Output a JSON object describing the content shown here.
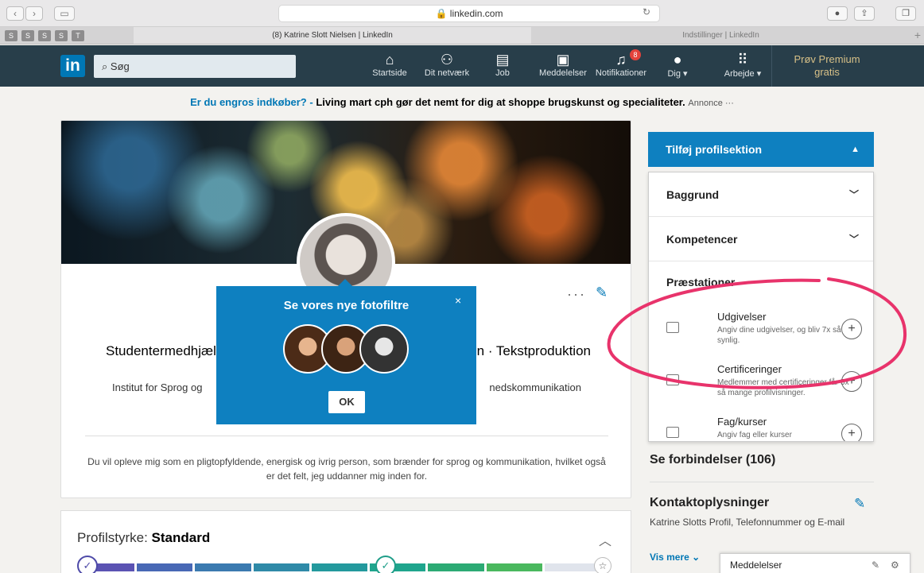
{
  "browser": {
    "address": "🔒 linkedin.com",
    "favorites": [
      "S",
      "S",
      "S",
      "S",
      "T"
    ],
    "tabs": [
      "(8) Katrine Slott Nielsen | LinkedIn",
      "Indstillinger | LinkedIn"
    ]
  },
  "nav": {
    "search_placeholder": "Søg",
    "items": [
      {
        "label": "Startside",
        "icon": "home-icon"
      },
      {
        "label": "Dit netværk",
        "icon": "network-icon"
      },
      {
        "label": "Job",
        "icon": "briefcase-icon"
      },
      {
        "label": "Meddelelser",
        "icon": "messages-icon"
      },
      {
        "label": "Notifikationer",
        "icon": "bell-icon",
        "badge": "8"
      },
      {
        "label": "Dig ▾",
        "icon": "avatar-icon"
      },
      {
        "label": "Arbejde ▾",
        "icon": "grid-icon"
      }
    ],
    "premium": "Prøv Premium gratis"
  },
  "ad": {
    "question": "Er du engros indkøber? -",
    "text": "Living mart cph gør det nemt for dig at shoppe brugskunst og specialiteter.",
    "note": "Annonce ···"
  },
  "profile": {
    "headline_left": "Studentermedhjæl",
    "headline_right": "n · Tekstproduktion",
    "school_left": "Institut for Sprog og",
    "school_right": "nedskommunikation",
    "summary": "Du vil opleve mig som en pligtopfyldende, energisk og ivrig person, som brænder for sprog og kommunikation, hvilket også er det felt, jeg uddanner mig inden for."
  },
  "popup": {
    "title": "Se vores nye fotofiltre",
    "close": "×",
    "ok": "OK"
  },
  "strength": {
    "label": "Profilstyrke:",
    "level": "Standard",
    "segments": [
      "#5b53b3",
      "#4868b5",
      "#3b7ab0",
      "#2f8aa8",
      "#23999d",
      "#1fa58d",
      "#2caa74",
      "#4ab85e",
      "#e0e4ec"
    ]
  },
  "sidebar": {
    "add_section": "Tilføj profilsektion",
    "sections": [
      "Baggrund",
      "Kompetencer"
    ],
    "subsection": "Præstationer",
    "items": [
      {
        "title": "Udgivelser",
        "desc": "Angiv dine udgivelser, og bliv 7x så synlig."
      },
      {
        "title": "Certificeringer",
        "desc": "Medlemmer med certificeringer får 5x så mange profilvisninger."
      },
      {
        "title": "Fag/kurser",
        "desc": "Angiv fag eller kurser"
      }
    ],
    "connections": "Se forbindelser (106)",
    "contact_title": "Kontaktoplysninger",
    "contact_text": "Katrine Slotts Profil, Telefonnummer og E-mail",
    "see_more": "Vis mere ⌄",
    "messages": "Meddelelser"
  },
  "colors": {
    "nav_bg": "#283e4a",
    "accent": "#0077b5",
    "popup": "#0e80c0",
    "annotation": "#e8336b"
  }
}
